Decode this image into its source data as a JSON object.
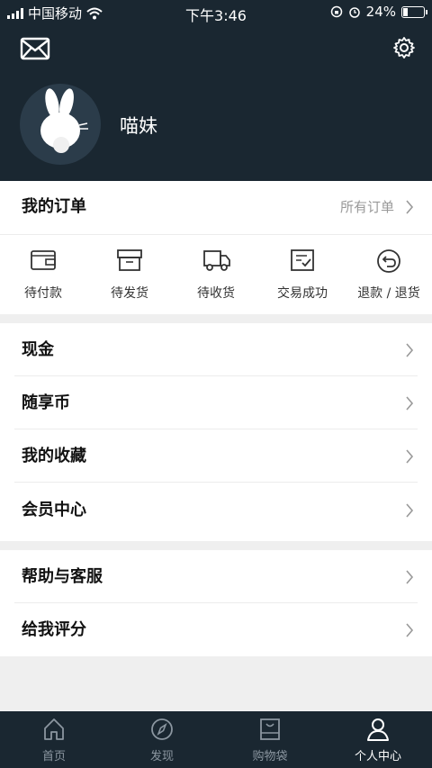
{
  "status": {
    "carrier": "中国移动",
    "time": "下午3:46",
    "battery": "24%",
    "battery_level": 0.24
  },
  "profile": {
    "nickname": "喵妹"
  },
  "orders": {
    "title": "我的订单",
    "all_label": "所有订单",
    "items": [
      {
        "label": "待付款",
        "icon": "wallet-icon"
      },
      {
        "label": "待发货",
        "icon": "box-icon"
      },
      {
        "label": "待收货",
        "icon": "truck-icon"
      },
      {
        "label": "交易成功",
        "icon": "check-doc-icon"
      },
      {
        "label": "退款 / 退货",
        "icon": "refund-icon"
      }
    ]
  },
  "menu1": {
    "items": [
      "现金",
      "随享币",
      "我的收藏",
      "会员中心"
    ]
  },
  "menu2": {
    "items": [
      "帮助与客服",
      "给我评分"
    ]
  },
  "tabs": [
    {
      "label": "首页",
      "icon": "home-icon"
    },
    {
      "label": "发现",
      "icon": "compass-icon"
    },
    {
      "label": "购物袋",
      "icon": "bag-icon"
    },
    {
      "label": "个人中心",
      "icon": "user-icon",
      "active": true
    }
  ],
  "colors": {
    "header_bg": "#1a2731",
    "page_bg": "#efefef",
    "muted": "#999999"
  }
}
